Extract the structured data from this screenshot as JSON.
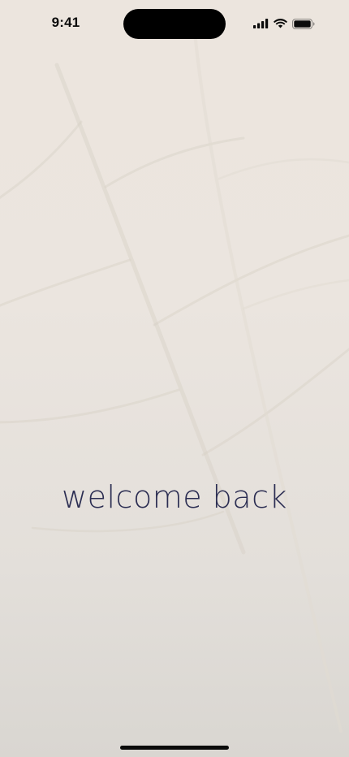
{
  "status_bar": {
    "time": "9:41",
    "icons": [
      "cellular-signal-icon",
      "wifi-icon",
      "battery-icon"
    ]
  },
  "welcome": {
    "text": "welcome back"
  },
  "colors": {
    "background_top": "#ece5de",
    "background_bottom": "#d9d6d1",
    "heading": "#2b2d52",
    "status_foreground": "#0b0b0b"
  }
}
